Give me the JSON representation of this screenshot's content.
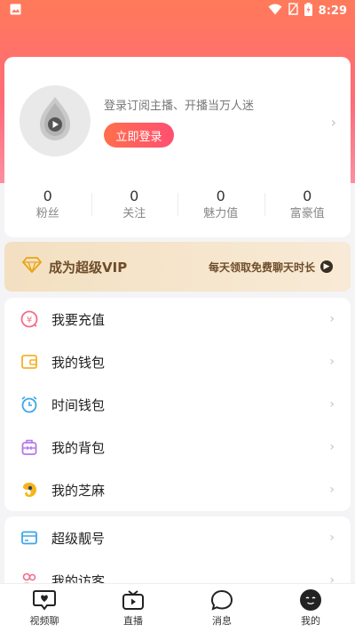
{
  "status_bar": {
    "time": "8:29",
    "icons": [
      "gallery-icon",
      "wifi-icon",
      "no-sim-icon",
      "battery-charging-icon"
    ]
  },
  "profile": {
    "tagline": "登录订阅主播、开播当万人迷",
    "login_label": "立即登录",
    "avatar_icon": "play-drop-avatar-icon"
  },
  "stats": [
    {
      "value": "0",
      "label": "粉丝"
    },
    {
      "value": "0",
      "label": "关注"
    },
    {
      "value": "0",
      "label": "魅力值"
    },
    {
      "value": "0",
      "label": "富豪值"
    }
  ],
  "vip": {
    "title": "成为超级VIP",
    "subtitle": "每天领取免费聊天时长",
    "icon": "diamond-icon"
  },
  "menu_group_1": [
    {
      "label": "我要充值",
      "icon": "recharge-icon"
    },
    {
      "label": "我的钱包",
      "icon": "wallet-icon"
    },
    {
      "label": "时间钱包",
      "icon": "alarm-clock-icon"
    },
    {
      "label": "我的背包",
      "icon": "backpack-icon"
    },
    {
      "label": "我的芝麻",
      "icon": "sesame-icon"
    }
  ],
  "menu_group_2": [
    {
      "label": "超级靓号",
      "icon": "card-icon"
    },
    {
      "label": "我的访客",
      "icon": "visitors-icon"
    }
  ],
  "tabbar": [
    {
      "label": "视频聊",
      "icon": "heart-chat-icon"
    },
    {
      "label": "直播",
      "icon": "tv-icon"
    },
    {
      "label": "消息",
      "icon": "message-bubble-icon"
    },
    {
      "label": "我的",
      "icon": "profile-face-icon"
    }
  ],
  "colors": {
    "header_gradient_top": "#ff7a5a",
    "header_gradient_bottom": "#fb8fa0",
    "login_button": "#ff5a62",
    "vip_background": "#f3e0c1",
    "vip_text": "#6e4d2a"
  }
}
